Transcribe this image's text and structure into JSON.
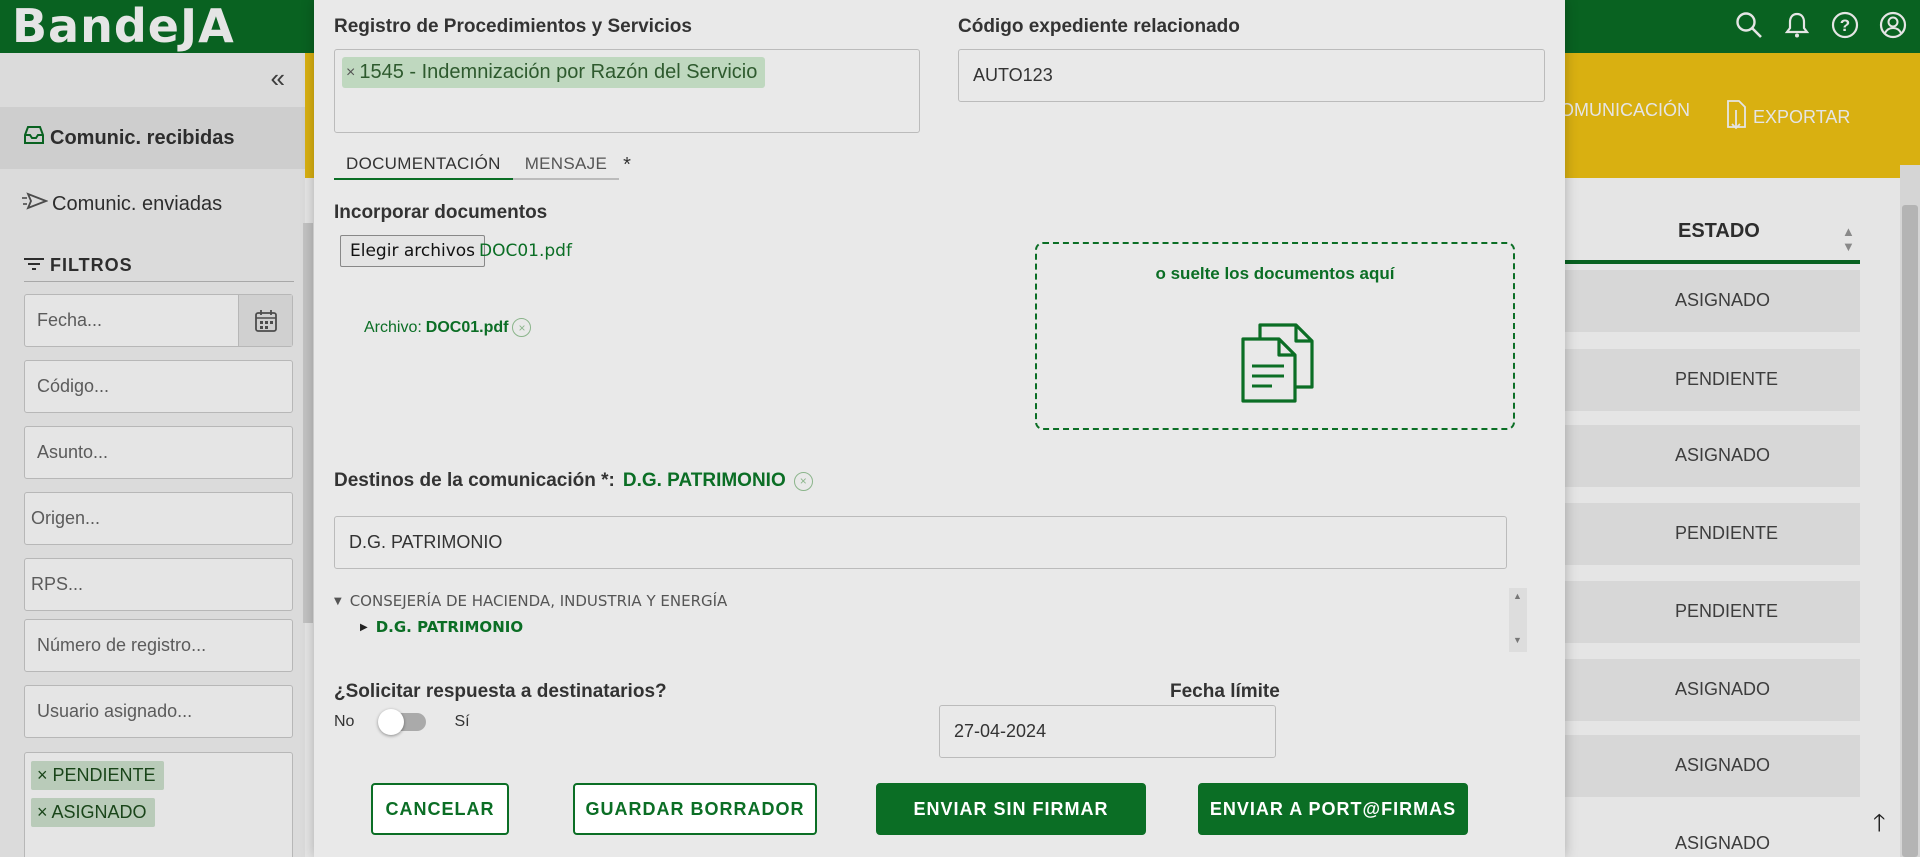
{
  "app": {
    "brand": "BandeJA"
  },
  "header_icons": [
    "search-icon",
    "bell-icon",
    "help-icon",
    "user-icon"
  ],
  "sidebar": {
    "items": [
      {
        "label": "Comunic. recibidas",
        "icon": "inbox-icon"
      },
      {
        "label": "Comunic. enviadas",
        "icon": "send-icon"
      }
    ],
    "filters_title": "FILTROS",
    "filters": {
      "fecha": "Fecha...",
      "codigo": "Código...",
      "asunto": "Asunto...",
      "origen": "Origen...",
      "rps": "RPS...",
      "numero": "Número de registro...",
      "usuario": "Usuario asignado..."
    },
    "status_chips": [
      "PENDIENTE",
      "ASIGNADO"
    ]
  },
  "actions": {
    "comunicacion": "OMUNICACIÓN",
    "exportar": "EXPORTAR"
  },
  "table": {
    "estado_header": "ESTADO",
    "rows": [
      "ASIGNADO",
      "PENDIENTE",
      "ASIGNADO",
      "PENDIENTE",
      "PENDIENTE",
      "ASIGNADO",
      "ASIGNADO",
      "ASIGNADO"
    ]
  },
  "modal": {
    "rps_label": "Registro de Procedimientos y Servicios",
    "rps_chip": "1545 - Indemnización por Razón del Servicio",
    "expediente_label": "Código expediente relacionado",
    "expediente_value": "AUTO123",
    "tabs": {
      "doc": "DOCUMENTACIÓN",
      "msg": "MENSAJE",
      "required": "*"
    },
    "incorporar_label": "Incorporar documentos",
    "file_button": "Elegir archivos",
    "file_name": "DOC01.pdf",
    "archivo_label": "Archivo:",
    "archivo_name": "DOC01.pdf",
    "dropzone_text": "o suelte los documentos aquí",
    "destinos_label": "Destinos de la comunicación *:",
    "destinos_value": "D.G. PATRIMONIO",
    "destino_input": "D.G. PATRIMONIO",
    "tree": {
      "parent": "CONSEJERÍA DE HACIENDA, INDUSTRIA Y ENERGÍA",
      "child": "D.G. PATRIMONIO"
    },
    "respuesta_label": "¿Solicitar respuesta a destinatarios?",
    "toggle_no": "No",
    "toggle_si": "Sí",
    "respuesta_on": false,
    "fecha_limite_label": "Fecha límite",
    "fecha_limite_value": "27-04-2024",
    "buttons": {
      "cancel": "CANCELAR",
      "draft": "GUARDAR BORRADOR",
      "send": "ENVIAR SIN FIRMAR",
      "portafirmas": "ENVIAR A PORT@FIRMAS"
    }
  },
  "colors": {
    "primary": "#0b6e25",
    "accent": "#f2c514"
  }
}
